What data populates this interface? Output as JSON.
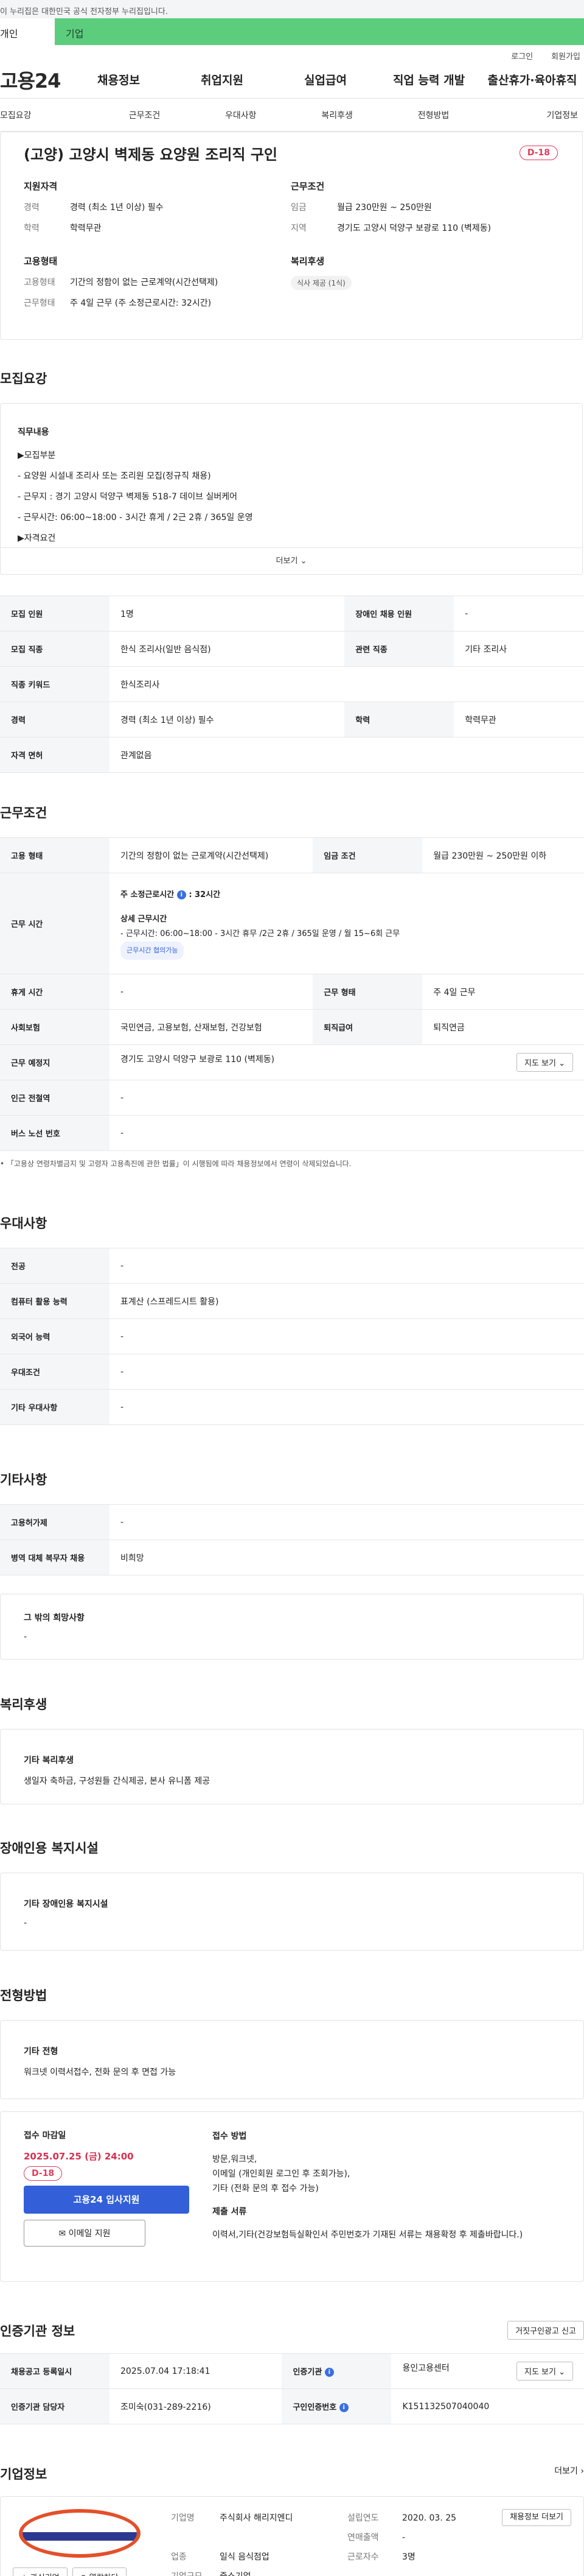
{
  "gov_banner": "이 누리집은 대한민국 공식 전자정부 누리집입니다.",
  "user_tabs": [
    "개인",
    "기업"
  ],
  "util_links": [
    "로그인",
    "회원가입"
  ],
  "logo": "고용24",
  "gnb": [
    "채용정보",
    "취업지원",
    "실업급여",
    "직업 능력 개발",
    "출산휴가·육아휴직"
  ],
  "snb": [
    "모집요강",
    "근무조건",
    "우대사항",
    "복리후생",
    "전형방법",
    "기업정보"
  ],
  "title": "(고양) 고양시 벽제동 요양원 조리직 구인",
  "dday": "D-18",
  "summary": {
    "qual_h": "지원자격",
    "career_k": "경력",
    "career_v": "경력 (최소 1년 이상) 필수",
    "edu_k": "학력",
    "edu_v": "학력무관",
    "cond_h": "근무조건",
    "wage_k": "임금",
    "wage_v": "월급 230만원 ~ 250만원",
    "region_k": "지역",
    "region_v": "경기도 고양시 덕양구 보광로 110 (벽제동)",
    "emp_h": "고용형태",
    "emptype_k": "고용형태",
    "emptype_v": "기간의 정함이 없는 근로계약(시간선택제)",
    "worktype_k": "근무형태",
    "worktype_v": "주 4일 근무 (주 소정근로시간: 32시간)",
    "welfare_h": "복리후생",
    "welfare_tag": "식사 제공 (1식)"
  },
  "recruit_h": "모집요강",
  "detail_h": "직무내용",
  "detail_lines": [
    "▶모집부분",
    "- 요양원 시설내 조리사 또는 조리원 모집(정규직 채용)",
    "- 근무지 : 경기 고양시 덕양구 벽제동 518-7 데이브 실버케어",
    "- 근무시간:  06:00~18:00  - 3시간 휴게 / 2근 2휴 / 365일 운영",
    "▶자격요건"
  ],
  "more": "더보기 ⌄",
  "recruit_rows": [
    [
      "모집 인원",
      "1명",
      "장애인 채용 인원",
      "-"
    ],
    [
      "모집 직종",
      "한식 조리사(일반 음식점)",
      "관련 직종",
      "기타 조리사"
    ],
    [
      "직종 키워드",
      "한식조리사"
    ],
    [
      "경력",
      "경력 (최소 1년 이상) 필수",
      "학력",
      "학력무관"
    ],
    [
      "자격 면허",
      "관계없음"
    ]
  ],
  "cond_h": "근무조건",
  "cond": {
    "emptype_k": "고용 형태",
    "emptype_v": "기간의 정함이 없는 근로계약(시간선택제)",
    "wage_k": "임금 조건",
    "wage_v": "월급 230만원 ~ 250만원 이하",
    "worktime_k": "근무 시간",
    "weekly": "주 소정근로시간",
    "weekly_v": ": 32시간",
    "detail_t": "상세 근무시간",
    "detail_v": "- 근무시간:  06:00~18:00 - 3시간 휴무 /2근 2휴 / 365일 운영 / 월 15~6회 근무",
    "chip": "근무시간 협의가능",
    "rest_k": "휴게 시간",
    "rest_v": "-",
    "form_k": "근무 형태",
    "form_v": "주 4일 근무",
    "ins_k": "사회보험",
    "ins_v": "국민연금, 고용보험, 산재보험, 건강보험",
    "ret_k": "퇴직급여",
    "ret_v": "퇴직연금",
    "loc_k": "근무 예정지",
    "loc_v": "경기도 고양시 덕양구 보광로 110 (벽제동)",
    "map": "지도 보기 ⌄",
    "sub_k": "인근 전철역",
    "sub_v": "-",
    "bus_k": "버스 노선 번호",
    "bus_v": "-",
    "note": "• 「고용상 연령차별금지 및 고령자 고용촉진에 관한 법률」이 시행됨에 따라 채용정보에서 연령이 삭제되었습니다."
  },
  "pref_h": "우대사항",
  "pref_rows": [
    [
      "전공",
      "-"
    ],
    [
      "컴퓨터 활용 능력",
      "표계산 (스프레드시트 활용)"
    ],
    [
      "외국어 능력",
      "-"
    ],
    [
      "우대조건",
      "-"
    ],
    [
      "기타 우대사항",
      "-"
    ]
  ],
  "etc_h": "기타사항",
  "etc_rows": [
    [
      "고용허가제",
      "-"
    ],
    [
      "병역 대체 복무자 채용",
      "비희망"
    ]
  ],
  "etc_box_t": "그 밖의 희망사항",
  "etc_box_v": "-",
  "welfare_h": "복리후생",
  "welfare_box_t": "기타 복리후생",
  "welfare_box_v": "생일자 축하금, 구성원들 간식제공, 본사 유니폼 제공",
  "disab_h": "장애인용 복지시설",
  "disab_box_t": "기타 장애인용 복지시설",
  "disab_box_v": "-",
  "proc_h": "전형방법",
  "proc_box_t": "기타 전형",
  "proc_box_v": "워크넷 이력서접수, 전화 문의 후 면접 가능",
  "apply": {
    "deadline_t": "접수 마감일",
    "deadline_v": "2025.07.25 (금) 24:00",
    "dday": "D-18",
    "apply_btn": "고용24 입사지원",
    "email_btn": "이메일 지원",
    "method_t": "접수 방법",
    "method_v1": "방문,워크넷,",
    "method_v2": "이메일 (개인회원 로그인 후 조회가능),",
    "method_v3": "기타 (전화 문의 후 접수 가능)",
    "doc_t": "제출 서류",
    "doc_v": "이력서,기타(건강보험득실확인서 주민번호가 기재된 서류는 채용확정 후 제출바랍니다.)"
  },
  "cert_h": "인증기관 정보",
  "cert_report": "거짓구인광고 신고",
  "cert_rows": [
    [
      "채용공고 등록일시",
      "2025.07.04 17:18:41",
      "인증기관",
      "용인고용센터"
    ],
    [
      "인증기관 담당자",
      "조미숙(031-289-2216)",
      "구인인증번호",
      "K151132507040040"
    ]
  ],
  "cert_map": "지도 보기 ⌄",
  "corp_h": "기업정보",
  "corp_more": "더보기 ›",
  "corp": {
    "name_k": "기업명",
    "name_v": "주식회사 해리지엔디",
    "year_k": "설립연도",
    "year_v": "2020. 03. 25",
    "sales_k": "연매출액",
    "sales_v": "-",
    "ind_k": "업종",
    "ind_v": "일식 음식점업",
    "emp_k": "근로자수",
    "emp_v": "3명",
    "size_k": "기업규모",
    "size_v": "중소기업",
    "recruit_btn": "채용정보 더보기",
    "fav_btn": "☆ 관심기업",
    "block_btn": "⊘ 열람차단"
  }
}
